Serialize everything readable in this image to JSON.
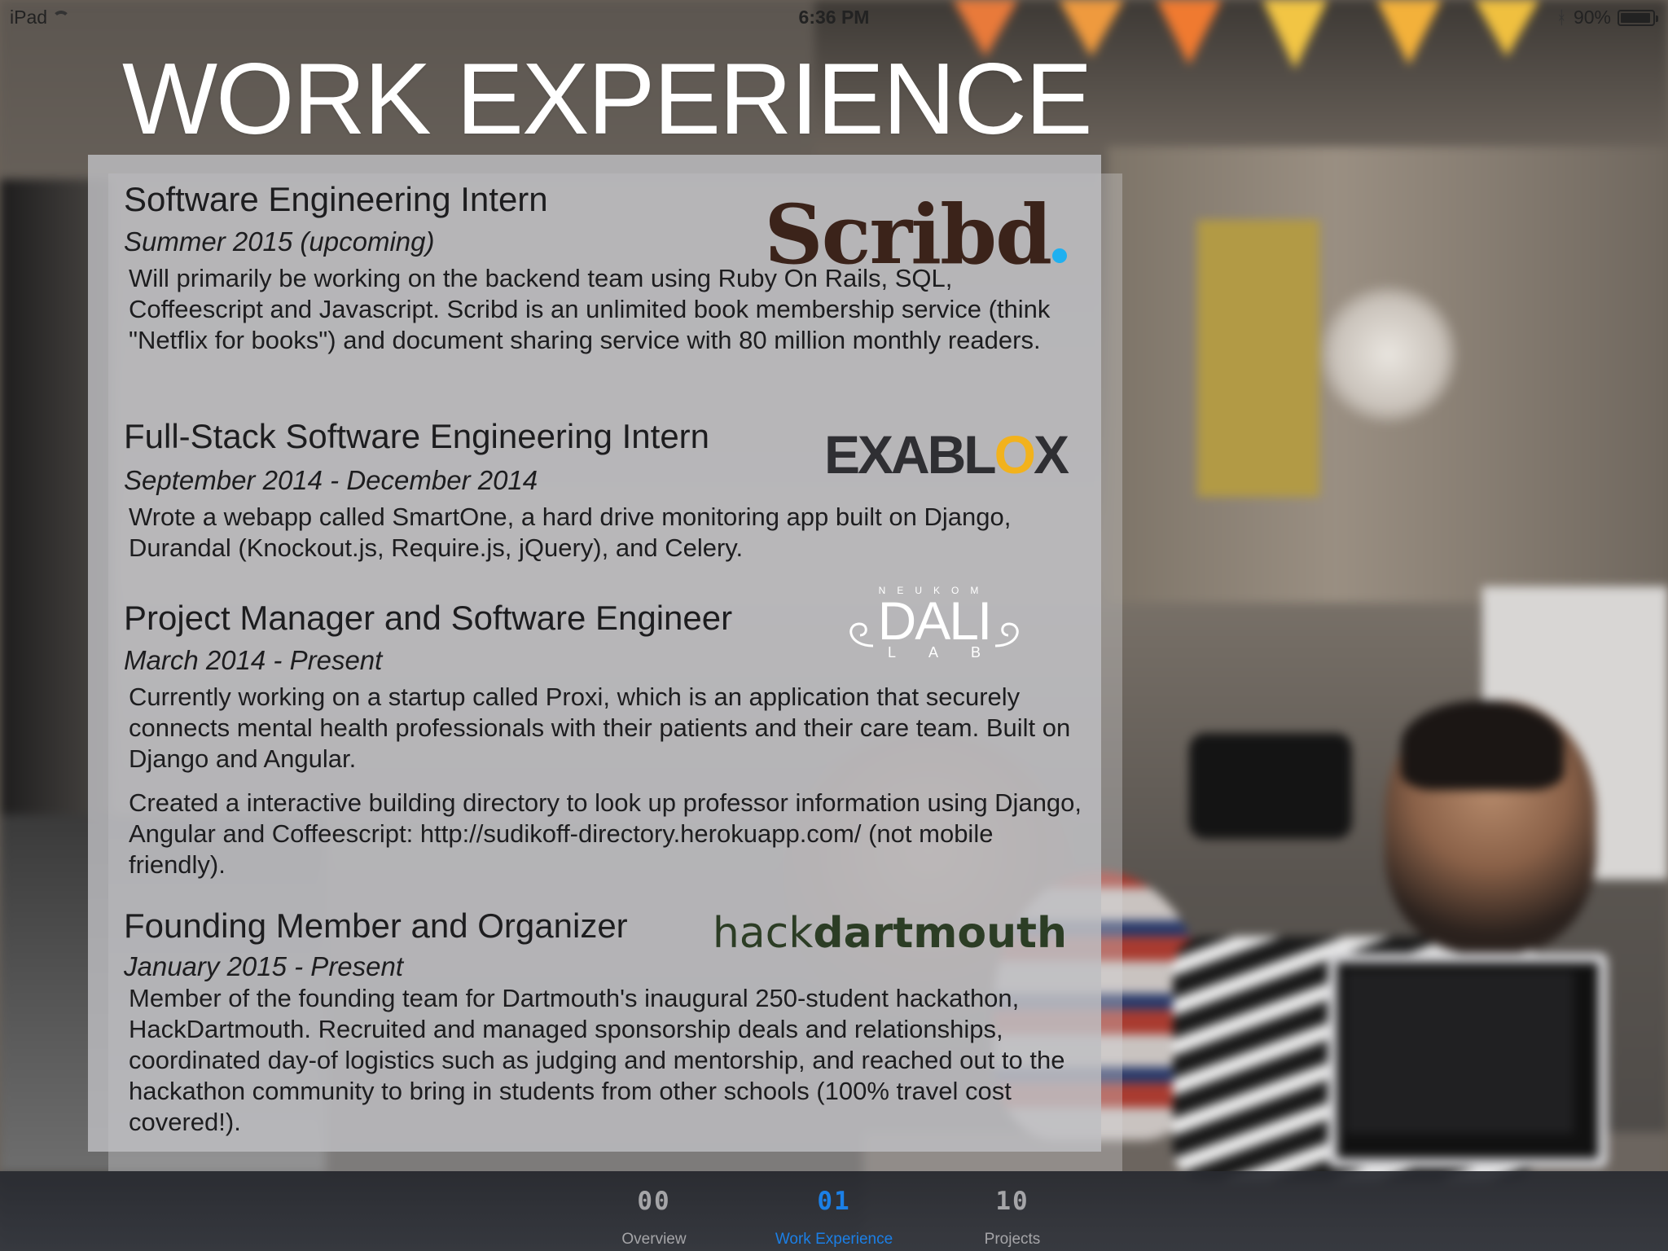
{
  "status_bar": {
    "carrier": "iPad",
    "time": "6:36 PM",
    "battery": "90%"
  },
  "page": {
    "title": "WORK EXPERIENCE"
  },
  "jobs": [
    {
      "title": "Software Engineering Intern",
      "dates": "Summer 2015 (upcoming)",
      "logo": "Scribd",
      "description": [
        "Will primarily be working on the backend team using Ruby On Rails, SQL, Coffeescript and Javascript. Scribd is an unlimited book membership service (think \"Netflix for books\") and document sharing service with 80 million monthly readers."
      ]
    },
    {
      "title": "Full-Stack Software Engineering Intern",
      "dates": "September 2014 - December 2014",
      "logo_parts": [
        "EXABL",
        "O",
        "X"
      ],
      "description": [
        "Wrote a webapp called SmartOne, a hard drive monitoring app built on Django, Durandal (Knockout.js, Require.js, jQuery), and Celery."
      ]
    },
    {
      "title": "Project Manager and Software Engineer",
      "dates": "March 2014 - Present",
      "logo": {
        "top": "NEUKOM",
        "main": "DALI",
        "bottom": "LAB"
      },
      "description": [
        "Currently working on a startup called Proxi, which is an application that securely connects mental health professionals with their patients and their care team. Built on Django and Angular.",
        "Created a interactive building directory to look up professor information using Django, Angular and Coffeescript: http://sudikoff-directory.herokuapp.com/ (not mobile friendly)."
      ]
    },
    {
      "title": "Founding Member and Organizer",
      "dates": "January 2015 - Present",
      "logo": {
        "light": "hack",
        "bold": "dartmouth"
      },
      "description": [
        "Member of the founding team for Dartmouth's inaugural 250-student hackathon, HackDartmouth. Recruited and managed sponsorship deals and relationships, coordinated day-of logistics such as judging and mentorship, and reached out to the hackathon community to bring in students from other schools (100% travel cost covered!)."
      ]
    }
  ],
  "tab_bar": {
    "tabs": [
      {
        "number": "00",
        "label": "Overview"
      },
      {
        "number": "01",
        "label": "Work Experience"
      },
      {
        "number": "10",
        "label": "Projects"
      }
    ],
    "active_index": 1,
    "active_color": "#1b7fe6",
    "inactive_color": "#a5a5a8"
  },
  "icons": {
    "bluetooth": "bluetooth-icon",
    "wifi": "wifi-icon",
    "battery": "battery-icon"
  }
}
